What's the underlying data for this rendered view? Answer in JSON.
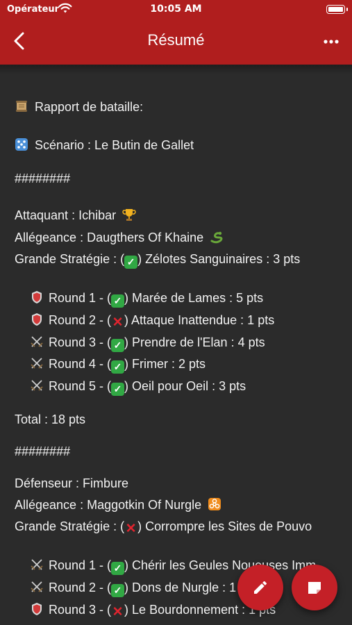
{
  "status": {
    "carrier": "Opérateur",
    "time": "10:05 AM"
  },
  "nav": {
    "title": "Résumé"
  },
  "report": {
    "heading": "Rapport de bataille:",
    "scenario": "Scénario : Le Butin de Gallet",
    "separator1": "########",
    "attacker": {
      "name_line": "Attaquant : Ichibar",
      "allegiance_line": "Allégeance : Daugthers Of Khaine",
      "strategy_prefix": "Grande Stratégie : (",
      "strategy_suffix": ") Zélotes Sanguinaires : 3 pts",
      "rounds": [
        {
          "prefix": "Round 1 - (",
          "suffix": ") Marée de Lames : 5 pts",
          "result": "check",
          "icon": "shield-icon"
        },
        {
          "prefix": "Round 2 - (",
          "suffix": ") Attaque Inattendue : 1 pts",
          "result": "cross",
          "icon": "shield-icon"
        },
        {
          "prefix": "Round 3 - (",
          "suffix": ") Prendre de l'Elan : 4 pts",
          "result": "check",
          "icon": "crossed-swords-icon"
        },
        {
          "prefix": "Round 4 - (",
          "suffix": ") Frimer : 2 pts",
          "result": "check",
          "icon": "crossed-swords-icon"
        },
        {
          "prefix": "Round 5 - (",
          "suffix": ") Oeil pour Oeil : 3 pts",
          "result": "check",
          "icon": "crossed-swords-icon"
        }
      ],
      "total": "Total : 18 pts"
    },
    "separator2": "########",
    "defender": {
      "name_line": "Défenseur : Fimbure",
      "allegiance_line": "Allégeance : Maggotkin Of Nurgle",
      "strategy_prefix": "Grande Stratégie : (",
      "strategy_suffix": ") Corrompre les Sites de Pouvo",
      "rounds": [
        {
          "prefix": "Round 1 - (",
          "suffix": ") Chérir les Geules Noueuses Imm",
          "result": "check",
          "icon": "crossed-swords-icon"
        },
        {
          "prefix": "Round 2 - (",
          "suffix": ") Dons de Nurgle : 1 pts",
          "result": "check",
          "icon": "crossed-swords-icon"
        },
        {
          "prefix": "Round 3 - (",
          "suffix": ") Le Bourdonnement : 1 pts",
          "result": "cross",
          "icon": "shield-icon"
        }
      ]
    }
  },
  "colors": {
    "header": "#b01e1e",
    "background": "#2b2b2b",
    "fab": "#c42027",
    "check": "#31a844",
    "cross": "#e0242e"
  }
}
